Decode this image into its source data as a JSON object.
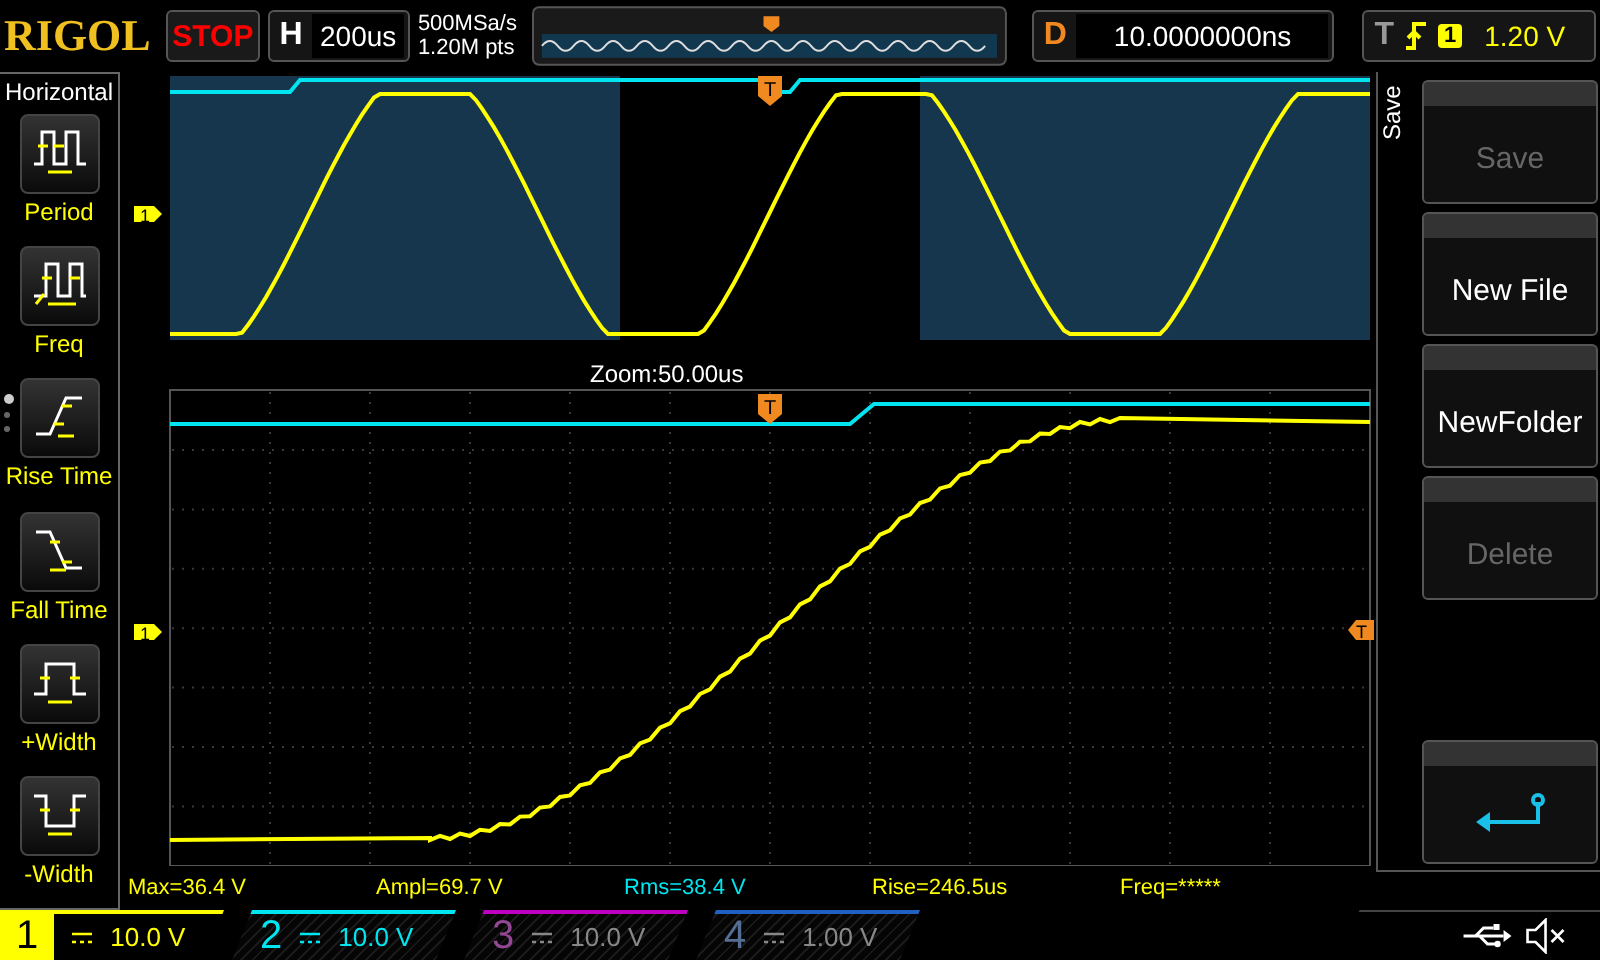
{
  "logo": "RIGOL",
  "run_state": "STOP",
  "horizontal": {
    "key": "H",
    "value": "200us"
  },
  "acquisition": {
    "sample_rate": "500MSa/s",
    "memory": "1.20M pts"
  },
  "delay": {
    "key": "D",
    "value": "10.0000000ns"
  },
  "trigger": {
    "key": "T",
    "source": "1",
    "level": "1.20 V"
  },
  "left_menu": {
    "title": "Horizontal",
    "items": [
      {
        "kind": "period",
        "label": "Period"
      },
      {
        "kind": "freq",
        "label": "Freq"
      },
      {
        "kind": "rise",
        "label": "Rise Time"
      },
      {
        "kind": "fall",
        "label": "Fall Time"
      },
      {
        "kind": "pwidth",
        "label": "+Width"
      },
      {
        "kind": "nwidth",
        "label": "-Width"
      }
    ],
    "page_dots": [
      {
        "selected": true
      },
      {
        "selected": false
      },
      {
        "selected": false
      }
    ]
  },
  "display": {
    "zoom_label": "Zoom:50.00us",
    "overview_channel_marker": "1",
    "zoom_channel_marker": "1",
    "overview_trigger_marker": "T",
    "zoom_trigger_marker": "T",
    "trigger_level_marker": "T"
  },
  "measurements": [
    "Max=36.4 V",
    "Ampl=69.7 V",
    "Rms=38.4 V",
    "Rise=246.5us",
    "Freq=*****"
  ],
  "right_menu": {
    "title": "Save",
    "buttons": [
      {
        "kind": "text",
        "label": "Save",
        "disabled": true
      },
      {
        "kind": "text",
        "label": "New File",
        "disabled": false
      },
      {
        "kind": "text",
        "label": "NewFolder",
        "disabled": false
      },
      {
        "kind": "text",
        "label": "Delete",
        "disabled": true
      },
      {
        "kind": "blank"
      },
      {
        "kind": "back"
      }
    ]
  },
  "channels": [
    {
      "number": "1",
      "value": "10.0 V",
      "on": true,
      "selected": true,
      "color": "#ffff00"
    },
    {
      "number": "2",
      "value": "10.0 V",
      "on": true,
      "selected": false,
      "color": "#00e5f0"
    },
    {
      "number": "3",
      "value": "10.0 V",
      "on": false,
      "selected": false,
      "color": "#c000c0"
    },
    {
      "number": "4",
      "value": "1.00 V",
      "on": false,
      "selected": false,
      "color": "#2060c0"
    }
  ]
}
